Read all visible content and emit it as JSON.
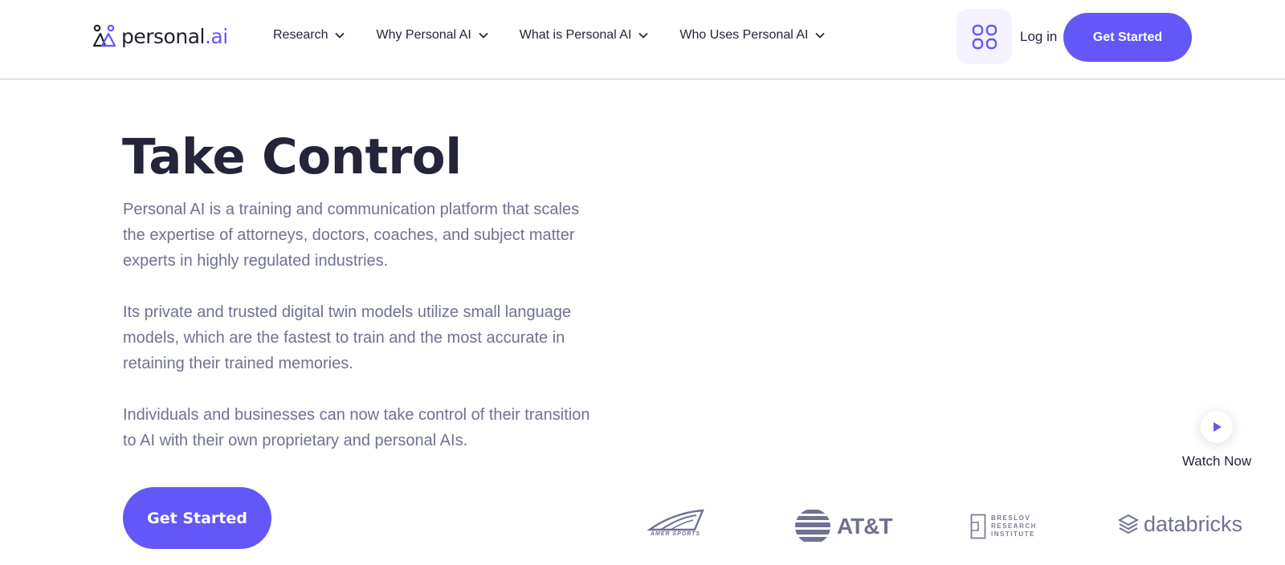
{
  "header": {
    "logo_text": "personal",
    "logo_dot": ".ai",
    "nav": [
      {
        "label": "Research"
      },
      {
        "label": "Why Personal AI"
      },
      {
        "label": "What is Personal AI"
      },
      {
        "label": "Who Uses Personal AI"
      }
    ],
    "login_label": "Log in",
    "cta_label": "Get Started"
  },
  "hero": {
    "title": "Take Control",
    "paragraphs": [
      "Personal AI is a training and communication platform that scales the expertise of attorneys, doctors, coaches, and subject matter experts in highly regulated industries.",
      "Its private and trusted digital twin models utilize small language models, which are the fastest to train and the most accurate in retaining their trained memories.",
      "Individuals and businesses can now take control of their transition to AI with their own proprietary and personal AIs."
    ],
    "cta_label": "Get Started"
  },
  "watch": {
    "label": "Watch Now"
  },
  "logos": {
    "amer": "AMER SPORTS",
    "att": "AT&T",
    "breslov": [
      "BRESLOV",
      "RESEARCH",
      "INSTITUTE"
    ],
    "databricks": "databricks"
  },
  "colors": {
    "accent": "#6358f7",
    "text": "#24243a",
    "muted": "#6f7290"
  }
}
